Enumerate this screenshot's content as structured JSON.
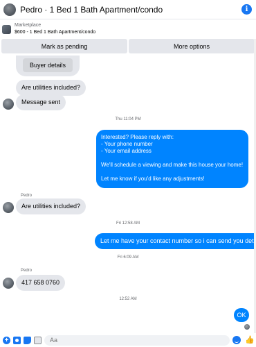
{
  "header": {
    "title": "Pedro · 1 Bed 1 Bath Apartment/condo",
    "info_icon": "i"
  },
  "listing": {
    "source": "Marketplace",
    "title": "$600 - 1 Bed 1 Bath Apartment/condo"
  },
  "actions": {
    "mark_pending": "Mark as pending",
    "more_options": "More options"
  },
  "messages": {
    "buyer_details": "Buyer details",
    "utilities_1": "Are utilities included?",
    "message_sent": "Message sent",
    "time_1": "Thu 11:04 PM",
    "auto_reply_lines": [
      "Interested? Please reply with:",
      "- Your phone number",
      "- Your email address",
      "",
      "We'll schedule a viewing and make this house your home!",
      "",
      "Let me know if you'd like any adjustments!"
    ],
    "sender_1": "Pedro",
    "utilities_2": "Are utilities included?",
    "time_2": "Fri 12:58 AM",
    "contact_request": "Let me have your contact number so i can send you details",
    "time_3": "Fri 6:09 AM",
    "sender_2": "Pedro",
    "phone": "417 658 0760",
    "time_4": "12:52 AM",
    "ok": "OK"
  },
  "composer": {
    "placeholder": "Aa",
    "plus_icon": "+",
    "like_icon": "👍"
  },
  "colors": {
    "accent": "#1877f2",
    "outgoing_bubble": "#0084ff",
    "incoming_bubble": "#e4e6eb"
  }
}
